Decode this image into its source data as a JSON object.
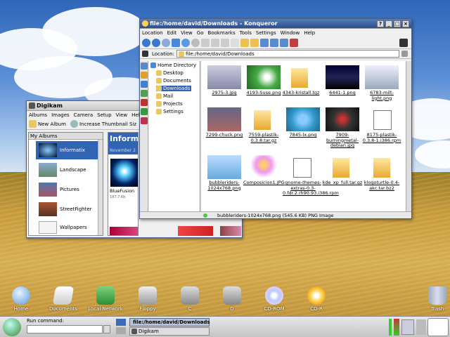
{
  "konqueror": {
    "title": "file:/home/david/Downloads - Konqueror",
    "menu": [
      "Location",
      "Edit",
      "View",
      "Go",
      "Bookmarks",
      "Tools",
      "Settings",
      "Window",
      "Help"
    ],
    "location_label": "Location:",
    "location_value": "file:/home/david/Downloads",
    "tree": [
      "Home Directory",
      "Desktop",
      "Documents",
      "Downloads",
      "Mail",
      "Projects",
      "Settings"
    ],
    "files": [
      "2975-3.jpg",
      "4193-Suse.png",
      "4343-kristall.tgz",
      "6441-1.png",
      "6783-milt-light.png",
      "7299-chuck.png",
      "7559-plastik-0.3.8.tar.gz",
      "7845-lx.png",
      "7909-burningmetal-debian.jpg",
      "8175-plastik-0.3.8-1.i386.rpm",
      "bubbleriders-1024x768.png",
      "Composicion1.JPG",
      "gnome-themes-extras-0.3-0.fdr.2.rh90.93.i386.rpm",
      "kde_xp_full.tar.gz",
      "klogoturtle-0.4-akc.tar.bz2"
    ],
    "status": "bubbleriders-1024x768.png (545.6 KB)  PNG Image"
  },
  "digikam": {
    "title": "Digikam",
    "menu": [
      "Albums",
      "Images",
      "Camera",
      "Setup",
      "View",
      "Help"
    ],
    "new_album": "New Album",
    "increase": "Increase Thumbnail Siz",
    "albums_header": "My Albums",
    "albums": [
      "Informatix",
      "Landscape",
      "Pictures",
      "StreetFighter",
      "Wallpapers"
    ],
    "heading": "Inform",
    "date": "November 2",
    "image_name": "BlueFusion",
    "image_size": "187.7 Kb"
  },
  "desktop_icons": [
    "Home",
    "Documents",
    "Local Network",
    "Floppy",
    "C",
    "D",
    "CD-ROM",
    "CD-R",
    "Trash"
  ],
  "taskbar": {
    "run_label": "Run command:",
    "tasks": [
      "file:/home/david/Downloads",
      "Digikam"
    ]
  }
}
